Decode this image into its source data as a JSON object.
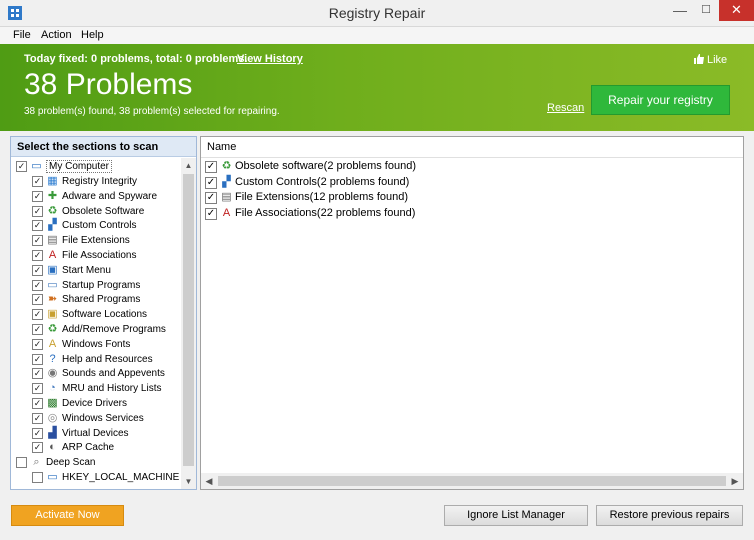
{
  "window": {
    "title": "Registry Repair",
    "min": "—",
    "max": "☐",
    "close": "✕"
  },
  "menu": [
    "File",
    "Action",
    "Help"
  ],
  "banner": {
    "today": "Today fixed: 0 problems, total: 0 problems.",
    "history": "View History",
    "like": "Like",
    "problems": "38 Problems",
    "summary": "38 problem(s) found, 38 problem(s) selected for repairing.",
    "rescan": "Rescan",
    "repair_btn": "Repair your registry"
  },
  "left": {
    "header": "Select the sections to scan",
    "root": "My Computer",
    "items": [
      {
        "label": "Registry Integrity",
        "icon": "grid-icon",
        "glyph": "▦",
        "color": "#2a7bd0"
      },
      {
        "label": "Adware and Spyware",
        "icon": "puzzle-icon",
        "glyph": "✚",
        "color": "#3a9a3a"
      },
      {
        "label": "Obsolete Software",
        "icon": "trash-icon",
        "glyph": "♻",
        "color": "#3a9a3a"
      },
      {
        "label": "Custom Controls",
        "icon": "blocks-icon",
        "glyph": "▞",
        "color": "#2a6fc0"
      },
      {
        "label": "File Extensions",
        "icon": "file-icon",
        "glyph": "▤",
        "color": "#666666"
      },
      {
        "label": "File Associations",
        "icon": "font-a-icon",
        "glyph": "A",
        "color": "#c02020"
      },
      {
        "label": "Start Menu",
        "icon": "start-menu-icon",
        "glyph": "▣",
        "color": "#2a6fc0"
      },
      {
        "label": "Startup Programs",
        "icon": "startup-icon",
        "glyph": "▭",
        "color": "#4a7fc0"
      },
      {
        "label": "Shared Programs",
        "icon": "share-icon",
        "glyph": "➽",
        "color": "#d07020"
      },
      {
        "label": "Software Locations",
        "icon": "folder-icon",
        "glyph": "▣",
        "color": "#c8a030"
      },
      {
        "label": "Add/Remove Programs",
        "icon": "recycle-icon",
        "glyph": "♻",
        "color": "#3a9a3a"
      },
      {
        "label": "Windows Fonts",
        "icon": "font-icon",
        "glyph": "A",
        "color": "#c8a030"
      },
      {
        "label": "Help and Resources",
        "icon": "help-icon",
        "glyph": "?",
        "color": "#2a6fc0"
      },
      {
        "label": "Sounds and Appevents",
        "icon": "sound-icon",
        "glyph": "◉",
        "color": "#777777"
      },
      {
        "label": "MRU and History Lists",
        "icon": "history-icon",
        "glyph": "◔",
        "color": "#4a7fc0"
      },
      {
        "label": "Device Drivers",
        "icon": "chip-icon",
        "glyph": "▩",
        "color": "#2a7a2a"
      },
      {
        "label": "Windows Services",
        "icon": "services-icon",
        "glyph": "◎",
        "color": "#888888"
      },
      {
        "label": "Virtual Devices",
        "icon": "device-icon",
        "glyph": "▟",
        "color": "#2a4fa0"
      },
      {
        "label": "ARP Cache",
        "icon": "network-icon",
        "glyph": "◐",
        "color": "#555555"
      }
    ],
    "deep_scan": "Deep Scan",
    "hkey": "HKEY_LOCAL_MACHINE"
  },
  "right": {
    "column": "Name",
    "rows": [
      {
        "label": "Obsolete software(2 problems found)",
        "icon": "trash-icon",
        "glyph": "♻",
        "color": "#3a9a3a"
      },
      {
        "label": "Custom Controls(2 problems found)",
        "icon": "blocks-icon",
        "glyph": "▞",
        "color": "#2a6fc0"
      },
      {
        "label": "File Extensions(12 problems found)",
        "icon": "file-icon",
        "glyph": "▤",
        "color": "#666666"
      },
      {
        "label": "File Associations(22 problems found)",
        "icon": "font-a-icon",
        "glyph": "A",
        "color": "#c02020"
      }
    ]
  },
  "buttons": {
    "activate": "Activate Now",
    "ignore": "Ignore List Manager",
    "restore": "Restore previous repairs"
  }
}
